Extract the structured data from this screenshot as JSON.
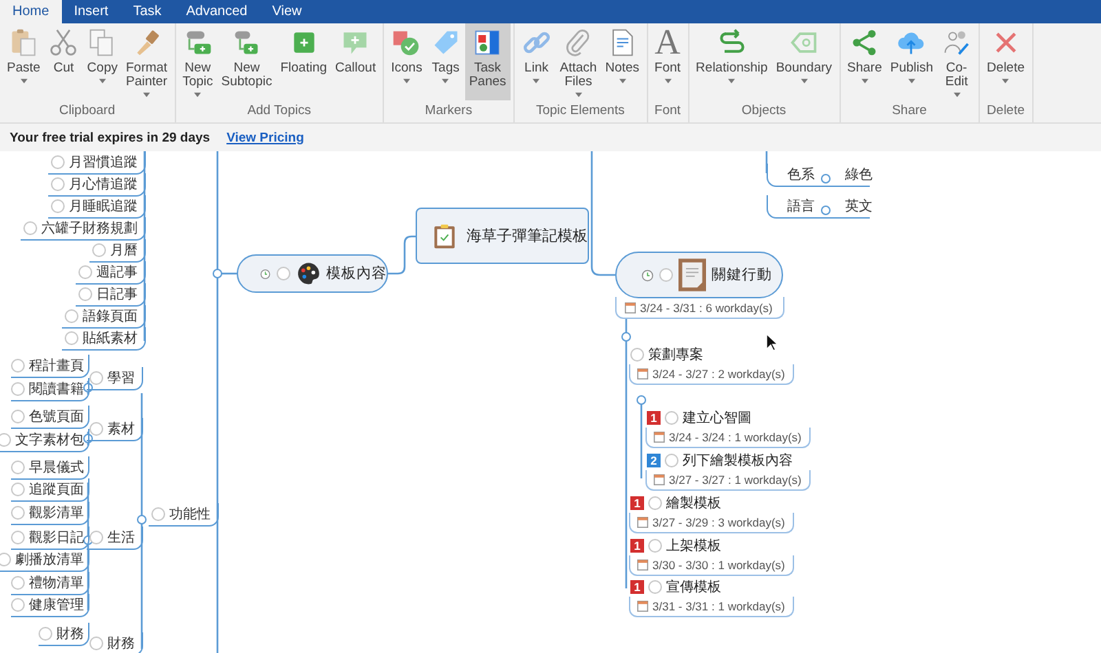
{
  "tabs": [
    {
      "label": "Home",
      "selected": true
    },
    {
      "label": "Insert",
      "selected": false
    },
    {
      "label": "Task",
      "selected": false
    },
    {
      "label": "Advanced",
      "selected": false
    },
    {
      "label": "View",
      "selected": false
    }
  ],
  "ribbon_groups": [
    {
      "label": "Clipboard",
      "buttons": [
        {
          "label": "Paste",
          "dropdown": true,
          "selected": false
        },
        {
          "label": "Cut",
          "dropdown": false,
          "selected": false
        },
        {
          "label": "Copy",
          "dropdown": true,
          "selected": false
        },
        {
          "label": "Format Painter",
          "dropdown": true,
          "selected": false
        }
      ]
    },
    {
      "label": "Add Topics",
      "buttons": [
        {
          "label": "New Topic",
          "dropdown": true,
          "selected": false
        },
        {
          "label": "New Subtopic",
          "dropdown": false,
          "selected": false
        },
        {
          "label": "Floating",
          "dropdown": false,
          "selected": false
        },
        {
          "label": "Callout",
          "dropdown": false,
          "selected": false
        }
      ]
    },
    {
      "label": "Markers",
      "buttons": [
        {
          "label": "Icons",
          "dropdown": true,
          "selected": false
        },
        {
          "label": "Tags",
          "dropdown": true,
          "selected": false
        },
        {
          "label": "Task Panes",
          "dropdown": false,
          "selected": true
        }
      ]
    },
    {
      "label": "Topic Elements",
      "buttons": [
        {
          "label": "Link",
          "dropdown": true,
          "selected": false
        },
        {
          "label": "Attach Files",
          "dropdown": true,
          "selected": false
        },
        {
          "label": "Notes",
          "dropdown": true,
          "selected": false
        }
      ]
    },
    {
      "label": "Font",
      "buttons": [
        {
          "label": "Font",
          "dropdown": true,
          "selected": false,
          "glyph": "A"
        }
      ]
    },
    {
      "label": "Objects",
      "buttons": [
        {
          "label": "Relationship",
          "dropdown": true,
          "selected": false
        },
        {
          "label": "Boundary",
          "dropdown": true,
          "selected": false
        }
      ]
    },
    {
      "label": "Share",
      "buttons": [
        {
          "label": "Share",
          "dropdown": true,
          "selected": false
        },
        {
          "label": "Publish",
          "dropdown": true,
          "selected": false
        },
        {
          "label": "Co-Edit",
          "dropdown": true,
          "selected": false
        }
      ]
    },
    {
      "label": "Delete",
      "buttons": [
        {
          "label": "Delete",
          "dropdown": true,
          "selected": false
        }
      ]
    }
  ],
  "trial_bar": {
    "message": "Your free trial expires in 29 days",
    "link": "View Pricing"
  },
  "mind_map": {
    "upper_topics": [
      "月習慣追蹤",
      "月心情追蹤",
      "月睡眠追蹤",
      "六罐子財務規劃",
      "月曆",
      "週記事",
      "日記事",
      "語錄頁面",
      "貼紙素材"
    ],
    "template_topic": "模板內容",
    "central_topic": "海草子彈筆記模板",
    "function_topic": {
      "text": "功能性",
      "children": [
        {
          "text": "學習",
          "children": [
            {
              "text": "程計畫頁"
            },
            {
              "text": "閱讀書籍"
            }
          ]
        },
        {
          "text": "素材",
          "children": [
            {
              "text": "色號頁面"
            },
            {
              "text": "文字素材包"
            }
          ]
        },
        {
          "text": "生活",
          "children": [
            {
              "text": "早晨儀式"
            },
            {
              "text": "追蹤頁面"
            },
            {
              "text": "觀影清單"
            },
            {
              "text": "觀影日記"
            },
            {
              "text": "劇播放清單"
            },
            {
              "text": "禮物清單"
            },
            {
              "text": "健康管理"
            }
          ]
        },
        {
          "text": "財務",
          "children": [
            {
              "text": "財務"
            }
          ]
        }
      ]
    },
    "properties": [
      {
        "label": "色系",
        "value": "綠色"
      },
      {
        "label": "語言",
        "value": "英文"
      }
    ],
    "key_action": {
      "text": "關鍵行動",
      "date": "3/24 - 3/31 : 6 workday(s)",
      "tasks": [
        {
          "text": "策劃專案",
          "date": "3/24 - 3/27 : 2 workday(s)",
          "children": [
            {
              "text": "建立心智圖",
              "priority": "1",
              "color": "#d32f2f",
              "date": "3/24 - 3/24 : 1 workday(s)"
            },
            {
              "text": "列下繪製模板內容",
              "priority": "2",
              "color": "#2f86d6",
              "date": "3/27 - 3/27 : 1 workday(s)"
            }
          ]
        },
        {
          "text": "繪製模板",
          "priority": "1",
          "color": "#d32f2f",
          "date": "3/27 - 3/29 : 3 workday(s)"
        },
        {
          "text": "上架模板",
          "priority": "1",
          "color": "#d32f2f",
          "date": "3/30 - 3/30 : 1 workday(s)"
        },
        {
          "text": "宣傳模板",
          "priority": "1",
          "color": "#d32f2f",
          "date": "3/31 - 3/31 : 1 workday(s)"
        }
      ]
    }
  }
}
